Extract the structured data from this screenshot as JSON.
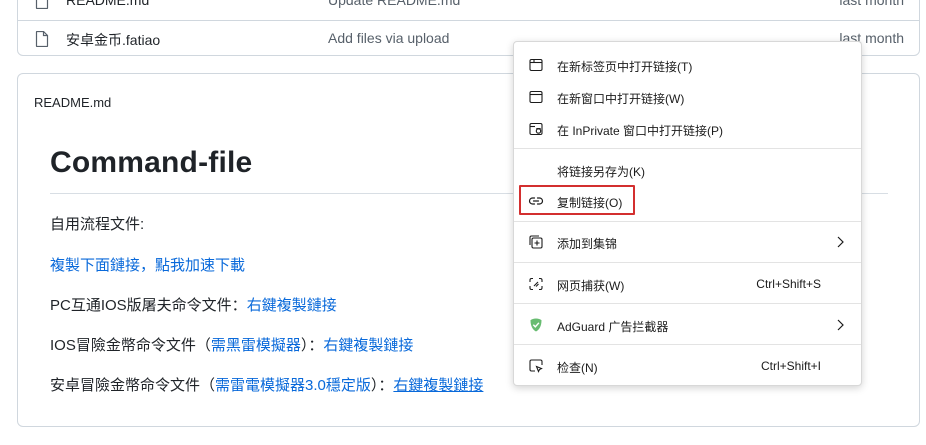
{
  "files": [
    {
      "name": "README.md",
      "message": "Update README.md",
      "date": "last month"
    },
    {
      "name": "安卓金币.fatiao",
      "message": "Add files via upload",
      "date": "last month"
    }
  ],
  "readme": {
    "header": "README.md",
    "title": "Command-file",
    "line1": "自用流程文件:",
    "line2_link": "複製下面鏈接，點我加速下載",
    "line3_text": "PC互通IOS版屠夫命令文件：",
    "line3_link": "右鍵複製鏈接",
    "line4_text": "IOS冒險金幣命令文件（",
    "line4_link1": "需黑雷模擬器",
    "line4_mid": "）：",
    "line4_link2": "右鍵複製鏈接",
    "line5_text": "安卓冒險金幣命令文件（",
    "line5_link1": "需雷電模擬器3.0穩定版",
    "line5_mid": "）：",
    "line5_link2": "右鍵複製鏈接"
  },
  "context_menu": {
    "items": [
      {
        "label": "在新标签页中打开链接(T)",
        "icon": "new-tab-icon"
      },
      {
        "label": "在新窗口中打开链接(W)",
        "icon": "new-window-icon"
      },
      {
        "label": "在 InPrivate 窗口中打开链接(P)",
        "icon": "inprivate-icon"
      },
      {
        "label": "将链接另存为(K)"
      },
      {
        "label": "复制链接(O)",
        "icon": "link-icon"
      },
      {
        "label": "添加到集锦",
        "icon": "collections-icon"
      },
      {
        "label": "网页捕获(W)",
        "icon": "web-capture-icon",
        "shortcut": "Ctrl+Shift+S"
      },
      {
        "label": "AdGuard 广告拦截器",
        "icon": "adguard-shield-icon"
      },
      {
        "label": "检查(N)",
        "icon": "inspect-icon",
        "shortcut": "Ctrl+Shift+I"
      }
    ]
  },
  "colors": {
    "link": "#0969da",
    "highlight": "#d32f2f",
    "adguard": "#68bc71"
  }
}
